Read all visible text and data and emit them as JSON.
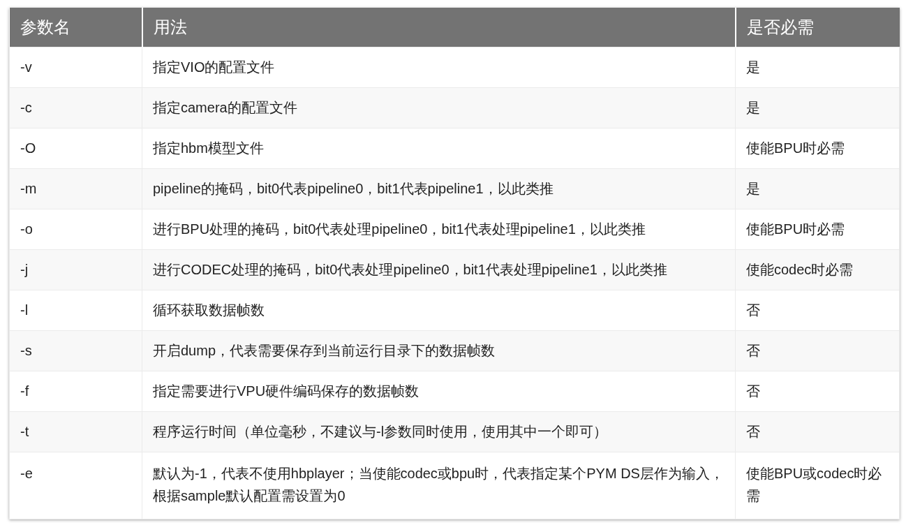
{
  "table": {
    "columns": [
      "参数名",
      "用法",
      "是否必需"
    ],
    "rows": [
      [
        "-v",
        "指定VIO的配置文件",
        "是"
      ],
      [
        "-c",
        "指定camera的配置文件",
        "是"
      ],
      [
        "-O",
        "指定hbm模型文件",
        "使能BPU时必需"
      ],
      [
        "-m",
        "pipeline的掩码，bit0代表pipeline0，bit1代表pipeline1，以此类推",
        "是"
      ],
      [
        "-o",
        "进行BPU处理的掩码，bit0代表处理pipeline0，bit1代表处理pipeline1，以此类推",
        "使能BPU时必需"
      ],
      [
        "-j",
        "进行CODEC处理的掩码，bit0代表处理pipeline0，bit1代表处理pipeline1，以此类推",
        "使能codec时必需"
      ],
      [
        "-l",
        "循环获取数据帧数",
        "否"
      ],
      [
        "-s",
        "开启dump，代表需要保存到当前运行目录下的数据帧数",
        "否"
      ],
      [
        "-f",
        "指定需要进行VPU硬件编码保存的数据帧数",
        "否"
      ],
      [
        "-t",
        "程序运行时间（单位毫秒，不建议与-l参数同时使用，使用其中一个即可）",
        "否"
      ],
      [
        "-e",
        "默认为-1，代表不使用hbplayer；当使能codec或bpu时，代表指定某个PYM DS层作为输入，根据sample默认配置需设置为0",
        "使能BPU或codec时必需"
      ]
    ]
  }
}
